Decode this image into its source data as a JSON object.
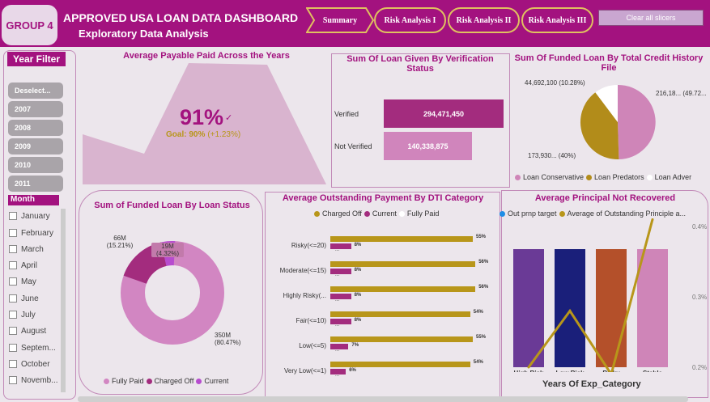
{
  "header": {
    "group": "GROUP 4",
    "title": "APPROVED USA LOAN DATA DASHBOARD",
    "subtitle": "Exploratory Data Analysis",
    "tabs": [
      "Summary",
      "Risk Analysis I",
      "Risk Analysis II",
      "Risk Analysis III"
    ],
    "clear_label": "Clear all slicers"
  },
  "sidebar": {
    "year_title": "Year Filter",
    "years": [
      "Deselect...",
      "2007",
      "2008",
      "2009",
      "2010",
      "2011"
    ],
    "month_title": "Month",
    "months": [
      "January",
      "February",
      "March",
      "April",
      "May",
      "June",
      "July",
      "August",
      "Septem...",
      "October",
      "Novemb..."
    ]
  },
  "kpi": {
    "title": "Average Payable Paid Across the Years",
    "value": "91%",
    "goal": "Goal: 90%",
    "delta": "(+1.23%)"
  },
  "verification": {
    "title": "Sum Of Loan Given By Verification Status",
    "rows": [
      {
        "label": "Verified",
        "value": "294,471,450",
        "amount": 294471450
      },
      {
        "label": "Not Verified",
        "value": "140,338,875",
        "amount": 140338875
      }
    ]
  },
  "credit": {
    "title": "Sum Of Funded Loan By Total Credit History File",
    "labels": [
      "44,692,100 (10.28%)",
      "216,18... (49.72...",
      "173,930... (40%)"
    ],
    "legend": [
      "Loan Conservative",
      "Loan Predators",
      "Loan Adver"
    ]
  },
  "status": {
    "title": "Sum of Funded Loan By Loan Status",
    "labels": [
      "66M (15.21%)",
      "19M (4.32%)",
      "350M (80.47%)"
    ],
    "legend": [
      "Fully Paid",
      "Charged Off",
      "Current"
    ]
  },
  "dti": {
    "title": "Average Outstanding Payment By DTI Category",
    "legend": [
      "Charged Off",
      "Current",
      "Fully Paid"
    ],
    "rows": [
      {
        "label": "Risky(<=20)",
        "a": "55%",
        "b": "8%",
        "c": "..."
      },
      {
        "label": "Moderate(<=15)",
        "a": "56%",
        "b": "8%",
        "c": "..."
      },
      {
        "label": "Highly Risky(...",
        "a": "56%",
        "b": "8%",
        "c": "..."
      },
      {
        "label": "Fair(<=10)",
        "a": "54%",
        "b": "8%",
        "c": "..."
      },
      {
        "label": "Low(<=5)",
        "a": "55%",
        "b": "7%",
        "c": "..."
      },
      {
        "label": "Very Low(<=1)",
        "a": "54%",
        "b": "6%",
        "c": "..."
      }
    ]
  },
  "principal": {
    "title": "Average Principal Not Recovered",
    "legend": [
      "Out prnp target",
      "Average of Outstanding Principle a..."
    ],
    "categories": [
      "High Risk",
      "Low Risk",
      "Risky",
      "Stable"
    ],
    "xlabel": "Years Of Exp_Category",
    "yticks": [
      "0.4%",
      "0.3%",
      "0.2%"
    ]
  },
  "chart_data": {
    "type": "bar",
    "categories": [
      "High Risk",
      "Low Risk",
      "Risky",
      "Stable"
    ],
    "xlabel": "Years Of Exp_Category",
    "ylim": [
      0.2,
      0.4
    ],
    "series": [
      {
        "name": "Out prnp target",
        "values": [
          0.4,
          0.4,
          0.4,
          0.4
        ]
      },
      {
        "name": "Average of Outstanding Principle a...",
        "values": [
          0.2,
          0.28,
          0.19,
          0.41
        ]
      }
    ]
  },
  "colors": {
    "brand": "#a3127f",
    "gold": "#b8961a",
    "pink": "#cf7fb6"
  }
}
